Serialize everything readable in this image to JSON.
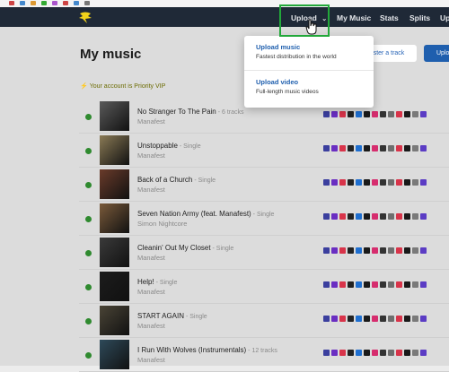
{
  "navbar": {
    "items": [
      {
        "label": "Upload"
      },
      {
        "label": "My Music"
      },
      {
        "label": "Stats"
      },
      {
        "label": "Splits"
      },
      {
        "label": "Up"
      }
    ]
  },
  "page": {
    "title": "My music",
    "priority_text": "Your account is Priority VIP",
    "register_button": "ster a track",
    "upload_button": "Uplo"
  },
  "dropdown": {
    "items": [
      {
        "title": "Upload music",
        "subtitle": "Fastest distribution in the world"
      },
      {
        "title": "Upload video",
        "subtitle": "Full-length music videos"
      }
    ]
  },
  "tracks": [
    {
      "title": "No Stranger To The Pain",
      "meta": " - 6 tracks",
      "artist": "Manafest",
      "cover_color": "#5a5a5a",
      "status": "live"
    },
    {
      "title": "Unstoppable",
      "meta": " - Single",
      "artist": "Manafest",
      "cover_color": "#8a7a55",
      "status": "live"
    },
    {
      "title": "Back of a Church",
      "meta": " - Single",
      "artist": "Manafest",
      "cover_color": "#6a3b2a",
      "status": "live"
    },
    {
      "title": "Seven Nation Army (feat. Manafest)",
      "meta": " - Single",
      "artist": "Simon Nightcore",
      "cover_color": "#7a5a3a",
      "status": "live"
    },
    {
      "title": "Cleanin' Out My Closet",
      "meta": " - Single",
      "artist": "Manafest",
      "cover_color": "#3a3a3a",
      "status": "live"
    },
    {
      "title": "Help!",
      "meta": " - Single",
      "artist": "Manafest",
      "cover_color": "#1c1c1c",
      "status": "live"
    },
    {
      "title": "START AGAIN",
      "meta": " - Single",
      "artist": "Manafest",
      "cover_color": "#4a4436",
      "status": "live"
    },
    {
      "title": "I Run With Wolves (Instrumentals)",
      "meta": " - 12 tracks",
      "artist": "Manafest",
      "cover_color": "#2e4a5a",
      "status": "live"
    }
  ],
  "store_badge_colors": [
    "#3b3f9e",
    "#6a2ec2",
    "#d8344a",
    "#222222",
    "#1f6fd0",
    "#1a1a1a",
    "#d62d6e",
    "#333333",
    "#6e6e6e",
    "#d8344a",
    "#1a1a1a",
    "#7a7a7a",
    "#5b3cc4"
  ]
}
